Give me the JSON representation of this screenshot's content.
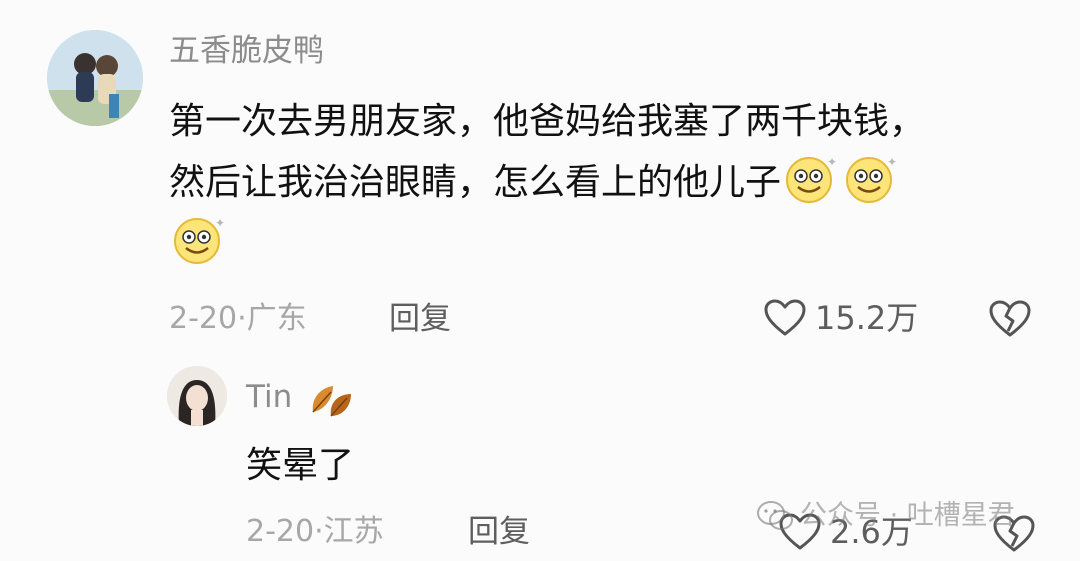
{
  "comment": {
    "username": "五香脆皮鸭",
    "text_line1": "第一次去男朋友家，他爸妈给我塞了两千块钱，",
    "text_line2": "然后让我治治眼睛，怎么看上的他儿子",
    "emoji_icon": "dizzy-smile-emoji",
    "meta": "2-20·广东",
    "reply_label": "回复",
    "likes": "15.2万"
  },
  "reply": {
    "username": "Tin",
    "badge_icon": "autumn-leaf-icon",
    "text": "笑晕了",
    "meta": "2-20·江苏",
    "reply_label": "回复",
    "likes": "2.6万"
  },
  "watermark": {
    "text": "公众号 · 吐槽星君",
    "icon": "wechat-icon"
  },
  "colors": {
    "background": "#fbfbfb",
    "username": "#8c8c8c",
    "meta": "#a7a7a7",
    "text": "#111111"
  }
}
